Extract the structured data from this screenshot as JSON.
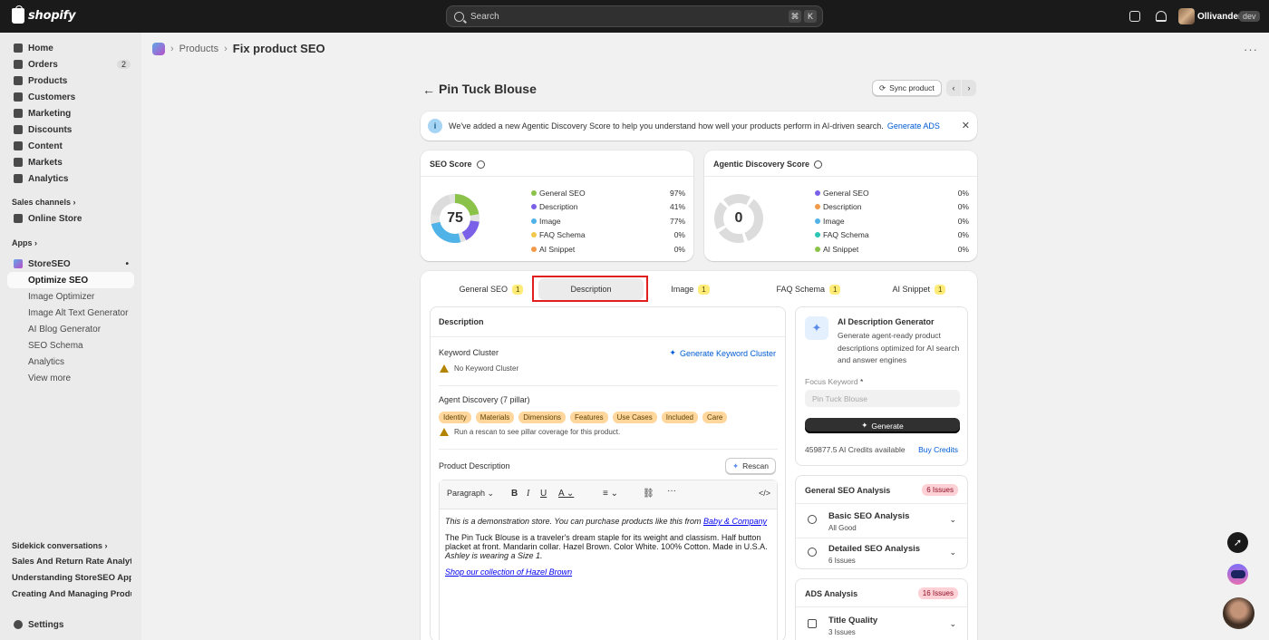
{
  "topbar": {
    "logo_text": "shopify",
    "search_placeholder": "Search",
    "shortcut_keys": [
      "⌘",
      "K"
    ],
    "store_name": "Ollivanders",
    "store_badge": "dev"
  },
  "sidebar": {
    "items": [
      {
        "label": "Home",
        "icon": "home-icon"
      },
      {
        "label": "Orders",
        "icon": "orders-icon",
        "count": "2"
      },
      {
        "label": "Products",
        "icon": "tag-icon"
      },
      {
        "label": "Customers",
        "icon": "person-icon"
      },
      {
        "label": "Marketing",
        "icon": "target-icon"
      },
      {
        "label": "Discounts",
        "icon": "discount-icon"
      },
      {
        "label": "Content",
        "icon": "content-icon"
      },
      {
        "label": "Markets",
        "icon": "globe-icon"
      },
      {
        "label": "Analytics",
        "icon": "chart-icon"
      }
    ],
    "sales_channels_label": "Sales channels",
    "online_store_label": "Online Store",
    "apps_label": "Apps",
    "app_name": "StoreSEO",
    "app_sub_items": [
      "Optimize SEO",
      "Image Optimizer",
      "Image Alt Text Generator",
      "AI Blog Generator",
      "SEO Schema",
      "Analytics",
      "View more"
    ],
    "sidekick_label": "Sidekick conversations",
    "conversations": [
      "Sales And Return Rate Analytics",
      "Understanding StoreSEO App Features",
      "Creating And Managing Products"
    ],
    "settings_label": "Settings"
  },
  "breadcrumb": {
    "parent": "Products",
    "current": "Fix product SEO"
  },
  "page": {
    "title": "Pin Tuck Blouse",
    "sync_label": "Sync product"
  },
  "banner": {
    "text": "We've added a new Agentic Discovery Score to help you understand how well your products perform in AI-driven search.",
    "link": "Generate ADS"
  },
  "seo_score": {
    "title": "SEO Score",
    "score": "75",
    "rows": [
      {
        "label": "General SEO",
        "value": "97%",
        "color": "#8bc34a"
      },
      {
        "label": "Description",
        "value": "41%",
        "color": "#7b61e8"
      },
      {
        "label": "Image",
        "value": "77%",
        "color": "#4fb3e8"
      },
      {
        "label": "FAQ Schema",
        "value": "0%",
        "color": "#f2c94c"
      },
      {
        "label": "AI Snippet",
        "value": "0%",
        "color": "#f2994a"
      }
    ]
  },
  "ads_score": {
    "title": "Agentic Discovery Score",
    "score": "0",
    "rows": [
      {
        "label": "General SEO",
        "value": "0%",
        "color": "#7b61e8"
      },
      {
        "label": "Description",
        "value": "0%",
        "color": "#f2994a"
      },
      {
        "label": "Image",
        "value": "0%",
        "color": "#4fb3e8"
      },
      {
        "label": "FAQ Schema",
        "value": "0%",
        "color": "#2bc5b4"
      },
      {
        "label": "AI Snippet",
        "value": "0%",
        "color": "#8bc34a"
      }
    ]
  },
  "tabs": [
    {
      "label": "General SEO",
      "badge": "1"
    },
    {
      "label": "Description",
      "badge": ""
    },
    {
      "label": "Image",
      "badge": "1"
    },
    {
      "label": "FAQ Schema",
      "badge": "1"
    },
    {
      "label": "AI Snippet",
      "badge": "1"
    }
  ],
  "description_panel": {
    "title": "Description",
    "keyword_cluster_label": "Keyword Cluster",
    "generate_cluster_label": "Generate Keyword Cluster",
    "no_cluster_text": "No Keyword Cluster",
    "agent_discovery_label": "Agent Discovery (7 pillar)",
    "pillars": [
      "Identity",
      "Materials",
      "Dimensions",
      "Features",
      "Use Cases",
      "Included",
      "Care"
    ],
    "rescan_hint": "Run a rescan to see pillar coverage for this product.",
    "product_description_label": "Product Description",
    "rescan_label": "Rescan",
    "editor": {
      "paragraph_select": "Paragraph",
      "line1_text": "This is a demonstration store. You can purchase products like this from ",
      "line1_link": "Baby & Company",
      "line2_text": "The Pin Tuck Blouse is a traveler's dream staple for its weight and classism. Half button placket at front. Mandarin collar. Hazel Brown. Color White. 100% Cotton. Made in U.S.A. ",
      "line2_italic": "Ashley is wearing a Size 1.",
      "line3_link": "Shop our collection of Hazel Brown"
    }
  },
  "ai_generator": {
    "title": "AI Description Generator",
    "description": "Generate agent-ready product descriptions optimized for AI search and answer engines",
    "focus_keyword_label": "Focus Keyword",
    "required_mark": "*",
    "focus_keyword_placeholder": "Pin Tuck Blouse",
    "generate_label": "Generate",
    "credits_text": "459877.5 AI Credits available",
    "buy_credits_label": "Buy Credits"
  },
  "general_analysis": {
    "title": "General SEO Analysis",
    "issues": "6 Issues",
    "rows": [
      {
        "name": "Basic SEO Analysis",
        "status": "All Good"
      },
      {
        "name": "Detailed SEO Analysis",
        "status": "6 Issues"
      }
    ]
  },
  "ads_analysis": {
    "title": "ADS Analysis",
    "issues": "16 Issues",
    "rows": [
      {
        "name": "Title Quality",
        "status": "3 Issues"
      }
    ]
  }
}
